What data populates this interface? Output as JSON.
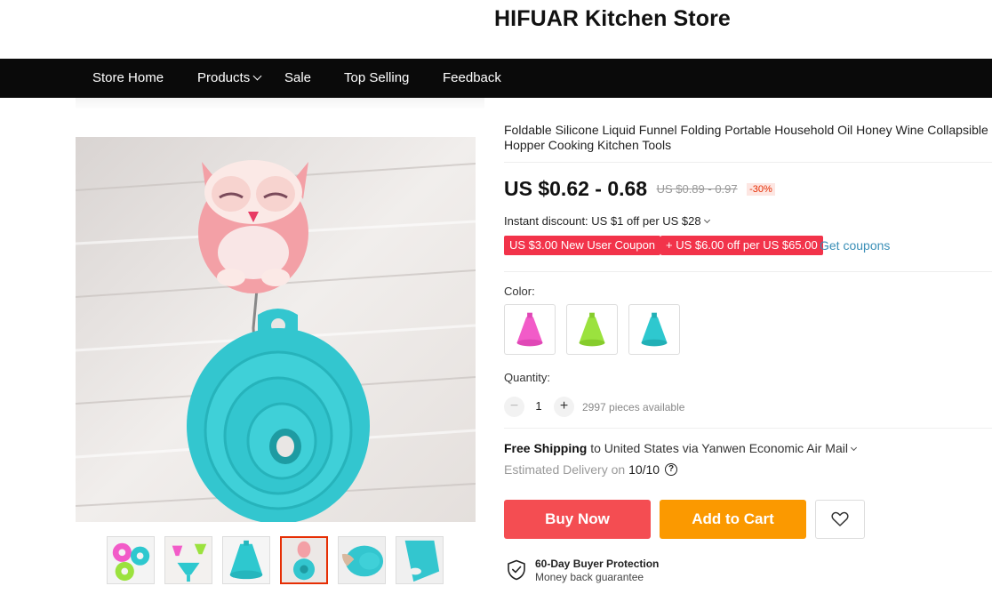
{
  "store": {
    "name": "HIFUAR Kitchen Store"
  },
  "nav": {
    "items": [
      {
        "label": "Store Home"
      },
      {
        "label": "Products"
      },
      {
        "label": "Sale"
      },
      {
        "label": "Top Selling"
      },
      {
        "label": "Feedback"
      }
    ]
  },
  "product": {
    "title": "Foldable Silicone Liquid Funnel Folding Portable Household Oil Honey Wine Collapsible Hopper Cooking Kitchen Tools",
    "price": "US $0.62 - 0.68",
    "original_price": "US $0.89 - 0.97",
    "discount": "-30%",
    "instant_discount": "Instant discount: US $1 off per US $28",
    "coupons": [
      {
        "label": "US $3.00 New User Coupon"
      },
      {
        "label": "+ US $6.00 off per US $65.00"
      }
    ],
    "get_coupons": "Get coupons",
    "color_label": "Color:",
    "colors": [
      {
        "name": "pink",
        "hex": "#f25bc8"
      },
      {
        "name": "green",
        "hex": "#9be23e"
      },
      {
        "name": "teal",
        "hex": "#2ec8cf"
      }
    ],
    "quantity_label": "Quantity:",
    "quantity": "1",
    "minus": "−",
    "plus": "+",
    "available": "2997 pieces available",
    "shipping_bold": "Free Shipping",
    "shipping_rest": " to United States via Yanwen Economic Air Mail",
    "delivery_label": "Estimated Delivery on ",
    "delivery_date": "10/10",
    "help": "?",
    "buy_now": "Buy Now",
    "add_to_cart": "Add to Cart",
    "protection_title": "60-Day Buyer Protection",
    "protection_sub": "Money back guarantee"
  },
  "colors": {
    "accent": "#f44d52",
    "cart": "#fb9900",
    "coupon": "#f2334a",
    "link": "#3a8fb7",
    "funnel": "#33c6cf",
    "owl": "#f3a0a6"
  },
  "icons": [
    "chevron-down-icon",
    "help-icon",
    "heart-icon",
    "shield-check-icon"
  ]
}
